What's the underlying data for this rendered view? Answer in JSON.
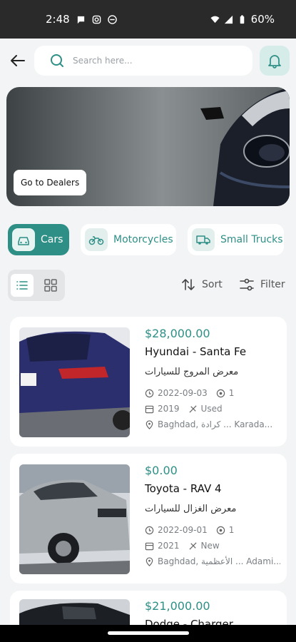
{
  "status": {
    "time": "2:48",
    "battery": "60%"
  },
  "search": {
    "placeholder": "Search here..."
  },
  "banner": {
    "dealers_button": "Go to Dealers"
  },
  "categories": [
    {
      "label": "Cars",
      "icon": "car-icon",
      "active": true
    },
    {
      "label": "Motorcycles",
      "icon": "motorcycle-icon",
      "active": false
    },
    {
      "label": "Small Trucks",
      "icon": "truck-icon",
      "active": false
    }
  ],
  "toolbar": {
    "sort_label": "Sort",
    "filter_label": "Filter"
  },
  "listings": [
    {
      "price": "$28,000.00",
      "title": "Hyundai - Santa Fe",
      "dealer": "معرض المروج للسيارات",
      "date": "2022-09-03",
      "views": "1",
      "year": "2019",
      "condition": "Used",
      "location": "Baghdad, كرادة ... Karada..."
    },
    {
      "price": "$0.00",
      "title": "Toyota - RAV 4",
      "dealer": "معرض الغزال للسيارات",
      "date": "2022-09-01",
      "views": "1",
      "year": "2021",
      "condition": "New",
      "location": "Baghdad, الأعظمية ... Adami..."
    },
    {
      "price": "$21,000.00",
      "title": "Dodge - Charger"
    }
  ],
  "colors": {
    "accent": "#2e8f86",
    "accent_light": "#d6ece9"
  }
}
